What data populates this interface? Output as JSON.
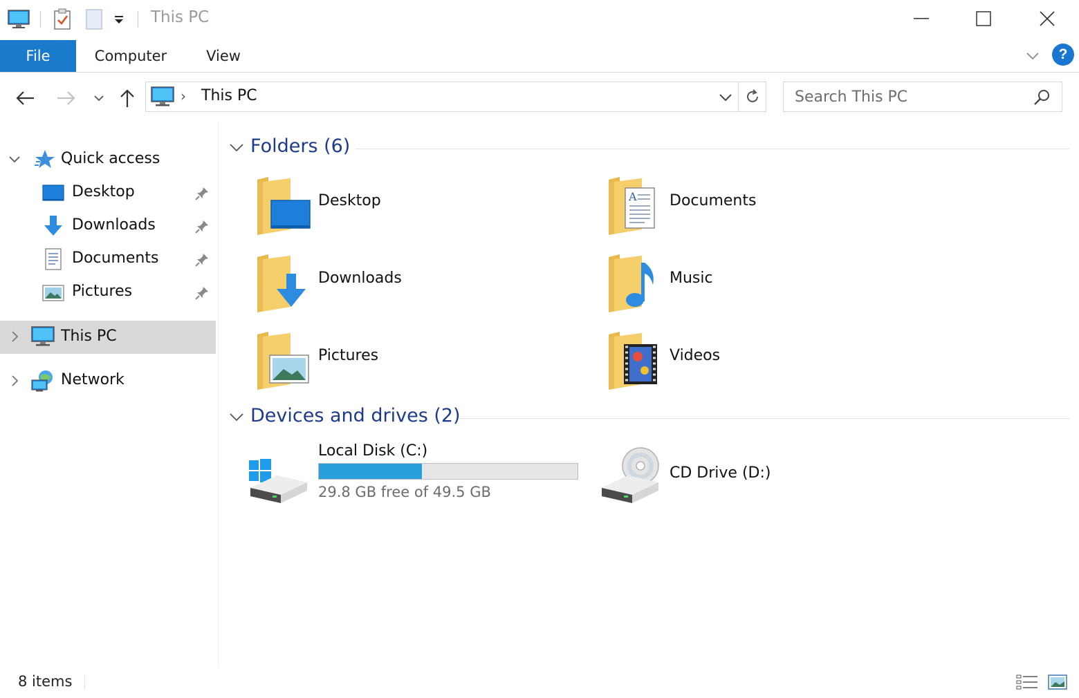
{
  "window": {
    "title": "This PC"
  },
  "ribbon": {
    "tabs": [
      {
        "label": "File"
      },
      {
        "label": "Computer"
      },
      {
        "label": "View"
      }
    ],
    "help_label": "?"
  },
  "address_bar": {
    "path": "This PC",
    "separator": "›"
  },
  "search": {
    "placeholder": "Search This PC"
  },
  "navigation": {
    "quick_access": {
      "label": "Quick access",
      "items": [
        {
          "label": "Desktop",
          "icon": "desktop-icon",
          "pinned": true
        },
        {
          "label": "Downloads",
          "icon": "downloads-icon",
          "pinned": true
        },
        {
          "label": "Documents",
          "icon": "documents-icon",
          "pinned": true
        },
        {
          "label": "Pictures",
          "icon": "pictures-icon",
          "pinned": true
        }
      ]
    },
    "this_pc": {
      "label": "This PC",
      "selected": true
    },
    "network": {
      "label": "Network"
    }
  },
  "content": {
    "folders_group": {
      "title": "Folders (6)",
      "items": [
        {
          "label": "Desktop",
          "icon": "desktop-folder-icon"
        },
        {
          "label": "Documents",
          "icon": "documents-folder-icon"
        },
        {
          "label": "Downloads",
          "icon": "downloads-folder-icon"
        },
        {
          "label": "Music",
          "icon": "music-folder-icon"
        },
        {
          "label": "Pictures",
          "icon": "pictures-folder-icon"
        },
        {
          "label": "Videos",
          "icon": "videos-folder-icon"
        }
      ]
    },
    "drives_group": {
      "title": "Devices and drives (2)",
      "items": [
        {
          "label": "Local Disk (C:)",
          "icon": "local-disk-icon",
          "free_text": "29.8 GB free of 49.5 GB",
          "used_fraction": 0.398
        },
        {
          "label": "CD Drive (D:)",
          "icon": "cd-drive-icon"
        }
      ]
    }
  },
  "status_bar": {
    "item_count": "8 items"
  },
  "colors": {
    "accent": "#1979ca",
    "group_title": "#1e3a8a",
    "selection": "#d9d9d9",
    "folder": "#f4cf6a",
    "drive_bar": "#26a0da"
  }
}
